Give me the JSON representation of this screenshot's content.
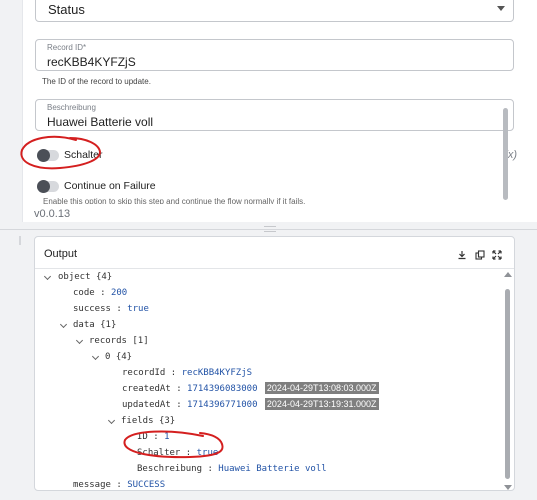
{
  "form": {
    "status_select": {
      "value": "Status"
    },
    "record_id": {
      "label": "Record ID*",
      "value": "recKBB4KYFZjS",
      "hint": "The ID of the record to update."
    },
    "beschreibung": {
      "label": "Beschreibung",
      "value": "Huawei Batterie voll"
    },
    "schalter_toggle": {
      "label": "Schalter",
      "checked": false
    },
    "variable_button": "(x)",
    "continue_toggle": {
      "label": "Continue on Failure",
      "checked": false
    },
    "continue_description": "Enable this option to skip this step and continue the flow normally if it fails."
  },
  "version": "v0.0.13",
  "output": {
    "title": "Output",
    "header_icons": [
      "download-icon",
      "copy-icon",
      "expand-icon"
    ],
    "tree": {
      "root_key": "object",
      "root_meta": "{4}",
      "code": {
        "key": "code",
        "value": "200"
      },
      "success": {
        "key": "success",
        "value": "true"
      },
      "data": {
        "key": "data",
        "meta": "{1}"
      },
      "records": {
        "key": "records",
        "meta": "[1]"
      },
      "item0": {
        "key": "0",
        "meta": "{4}"
      },
      "recordId": {
        "key": "recordId",
        "value": "recKBB4KYFZjS"
      },
      "createdAt": {
        "key": "createdAt",
        "value": "1714396083000",
        "date": "2024-04-29T13:08:03.000Z"
      },
      "updatedAt": {
        "key": "updatedAt",
        "value": "1714396771000",
        "date": "2024-04-29T13:19:31.000Z"
      },
      "fields": {
        "key": "fields",
        "meta": "{3}"
      },
      "id": {
        "key": "ID",
        "value": "1"
      },
      "schalter": {
        "key": "Schalter",
        "value": "true"
      },
      "beschreibung": {
        "key": "Beschreibung",
        "value": "Huawei Batterie voll"
      },
      "message": {
        "key": "message",
        "value": "SUCCESS"
      },
      "separator": ":"
    }
  },
  "annotation_color": "#d41f1f"
}
